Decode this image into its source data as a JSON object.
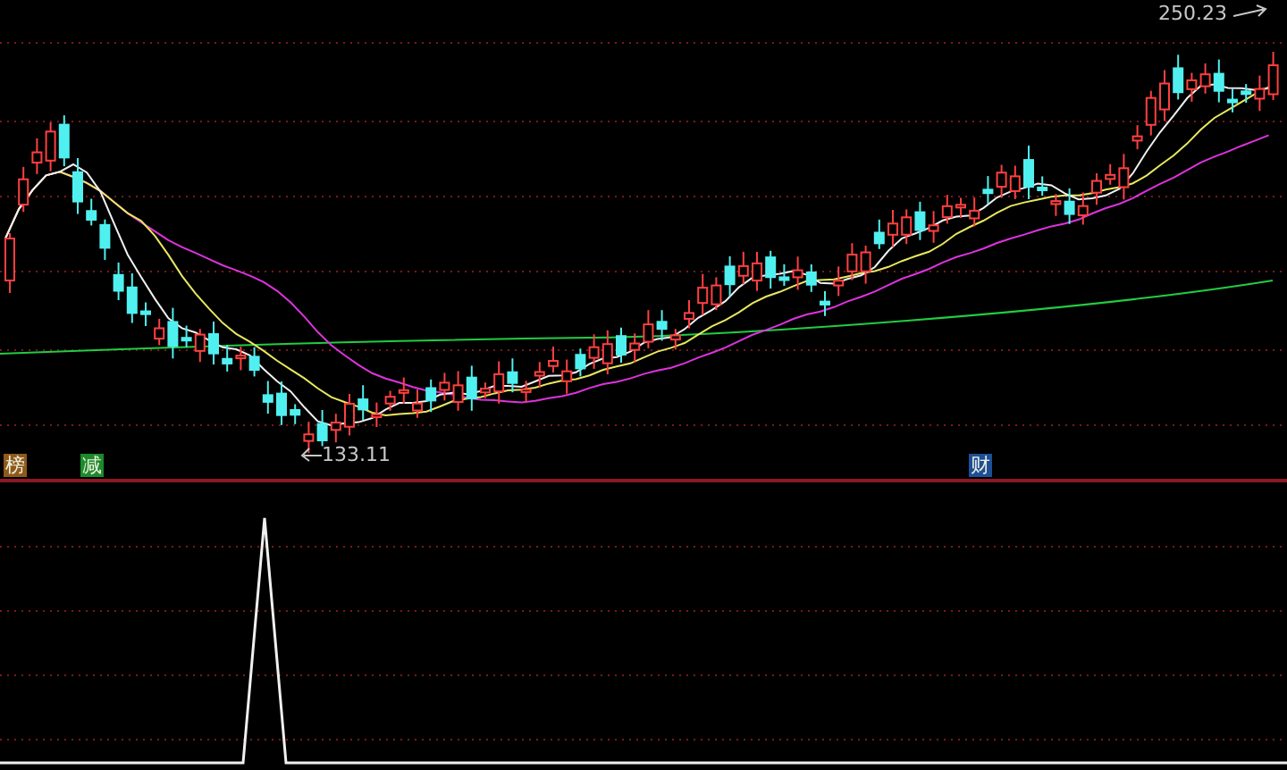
{
  "price_panel": {
    "high_label": "250.23",
    "low_label": "133.11",
    "signals": [
      {
        "text": "榜",
        "color": "#8e5a1c"
      },
      {
        "text": "减",
        "color": "#1c8a2a"
      },
      {
        "text": "财",
        "color": "#1d4f96"
      }
    ]
  }
}
